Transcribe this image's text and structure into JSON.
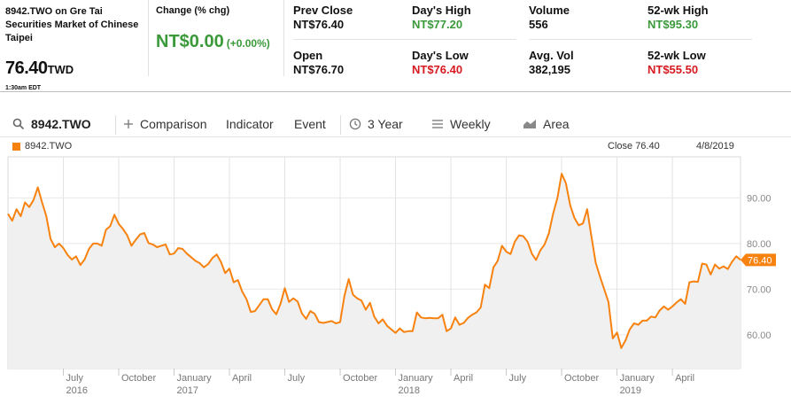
{
  "quote": {
    "symbol_line": "8942.TWO on Gre Tai Securities Market of Chinese Taipei",
    "price": "76.40",
    "currency": "TWD",
    "time": "1:30am EDT",
    "change_label": "Change (% chg)",
    "change_value": "NT$0.00",
    "change_pct": "(+0.00%)"
  },
  "stats": {
    "prev_close_label": "Prev Close",
    "prev_close": "NT$76.40",
    "open_label": "Open",
    "open": "NT$76.70",
    "days_high_label": "Day's High",
    "days_high": "NT$77.20",
    "days_low_label": "Day's Low",
    "days_low": "NT$76.40",
    "volume_label": "Volume",
    "volume": "556",
    "avg_vol_label": "Avg. Vol",
    "avg_vol": "382,195",
    "wk52_high_label": "52-wk High",
    "wk52_high": "NT$95.30",
    "wk52_low_label": "52-wk Low",
    "wk52_low": "NT$55.50"
  },
  "toolbar": {
    "search_value": "8942.TWO",
    "comparison": "Comparison",
    "indicator": "Indicator",
    "event": "Event",
    "range": "3 Year",
    "interval": "Weekly",
    "chart_type": "Area"
  },
  "colors": {
    "series": "#f7820f",
    "positive": "#3a9a3a",
    "negative": "#d71920",
    "area_fill": "#f0f0f0"
  },
  "chart_data": {
    "type": "area",
    "series": [
      {
        "name": "8942.TWO",
        "values": [
          86.5,
          85,
          87.5,
          86,
          89,
          88,
          89.5,
          92.3,
          89,
          86,
          81,
          79.2,
          80,
          79,
          77.5,
          76.5,
          77.2,
          75.3,
          76.5,
          78.8,
          80,
          80,
          79.5,
          83,
          83.8,
          86.3,
          84.3,
          83.2,
          81.8,
          79.5,
          80.8,
          82,
          82.3,
          80.1,
          79.8,
          79.2,
          79.5,
          79.8,
          77.6,
          77.8,
          79,
          78.8,
          77.8,
          77,
          76.2,
          75.7,
          74.8,
          75.5,
          76.8,
          77.6,
          76,
          73.5,
          74.5,
          71.5,
          72,
          69.5,
          67.8,
          65,
          65.2,
          66.5,
          67.8,
          67.8,
          65.6,
          64.5,
          66.8,
          70.2,
          67.2,
          68,
          67.3,
          64.7,
          63.5,
          65.2,
          64.6,
          62.8,
          62.6,
          62.8,
          63,
          62.5,
          62.8,
          68.5,
          72.2,
          68.8,
          68,
          67.5,
          65.5,
          67,
          64,
          62.5,
          63.4,
          62,
          61.2,
          60.4,
          61.4,
          60.6,
          60.8,
          60.8,
          64.9,
          63.8,
          63.6,
          63.7,
          63.6,
          63.6,
          64.4,
          60.8,
          61.4,
          63.8,
          62.2,
          62.6,
          63.7,
          64.4,
          64.9,
          66,
          71,
          70.2,
          74.8,
          76.2,
          79.5,
          78.2,
          77.7,
          80.4,
          81.8,
          81.6,
          80.4,
          77.8,
          76.4,
          78.5,
          79.8,
          82.2,
          86.5,
          90,
          95.3,
          93.2,
          88.4,
          85.6,
          84,
          84.4,
          87.5,
          81.5,
          75.8,
          72.8,
          70,
          67.2,
          59.2,
          60.5,
          57.1,
          58.8,
          61.2,
          62.5,
          62.2,
          63.1,
          63.1,
          64,
          63.8,
          65.3,
          66.2,
          65.5,
          66.2,
          67.1,
          67.8,
          66.8,
          71.5,
          71.7,
          71.6,
          75.6,
          75.4,
          73.2,
          75.4,
          74.5,
          75,
          74.4,
          76,
          77.2,
          76.4
        ]
      }
    ],
    "last": {
      "label": "Close",
      "value": "76.40",
      "date": "4/8/2019",
      "tag": "76.40"
    },
    "x_ticks": [
      {
        "label": "July",
        "year": "2016",
        "i": 13
      },
      {
        "label": "October",
        "year": "",
        "i": 26
      },
      {
        "label": "January",
        "year": "2017",
        "i": 39
      },
      {
        "label": "April",
        "year": "",
        "i": 52
      },
      {
        "label": "July",
        "year": "",
        "i": 65
      },
      {
        "label": "October",
        "year": "",
        "i": 78
      },
      {
        "label": "January",
        "year": "2018",
        "i": 91
      },
      {
        "label": "April",
        "year": "",
        "i": 104
      },
      {
        "label": "July",
        "year": "",
        "i": 117
      },
      {
        "label": "October",
        "year": "",
        "i": 130
      },
      {
        "label": "January",
        "year": "2019",
        "i": 143
      },
      {
        "label": "April",
        "year": "",
        "i": 156
      }
    ],
    "y_ticks": [
      60,
      70,
      80,
      90
    ],
    "ylim": [
      52.6,
      99
    ],
    "grid": true,
    "legend": "top-left",
    "xlabel": "",
    "ylabel": ""
  }
}
